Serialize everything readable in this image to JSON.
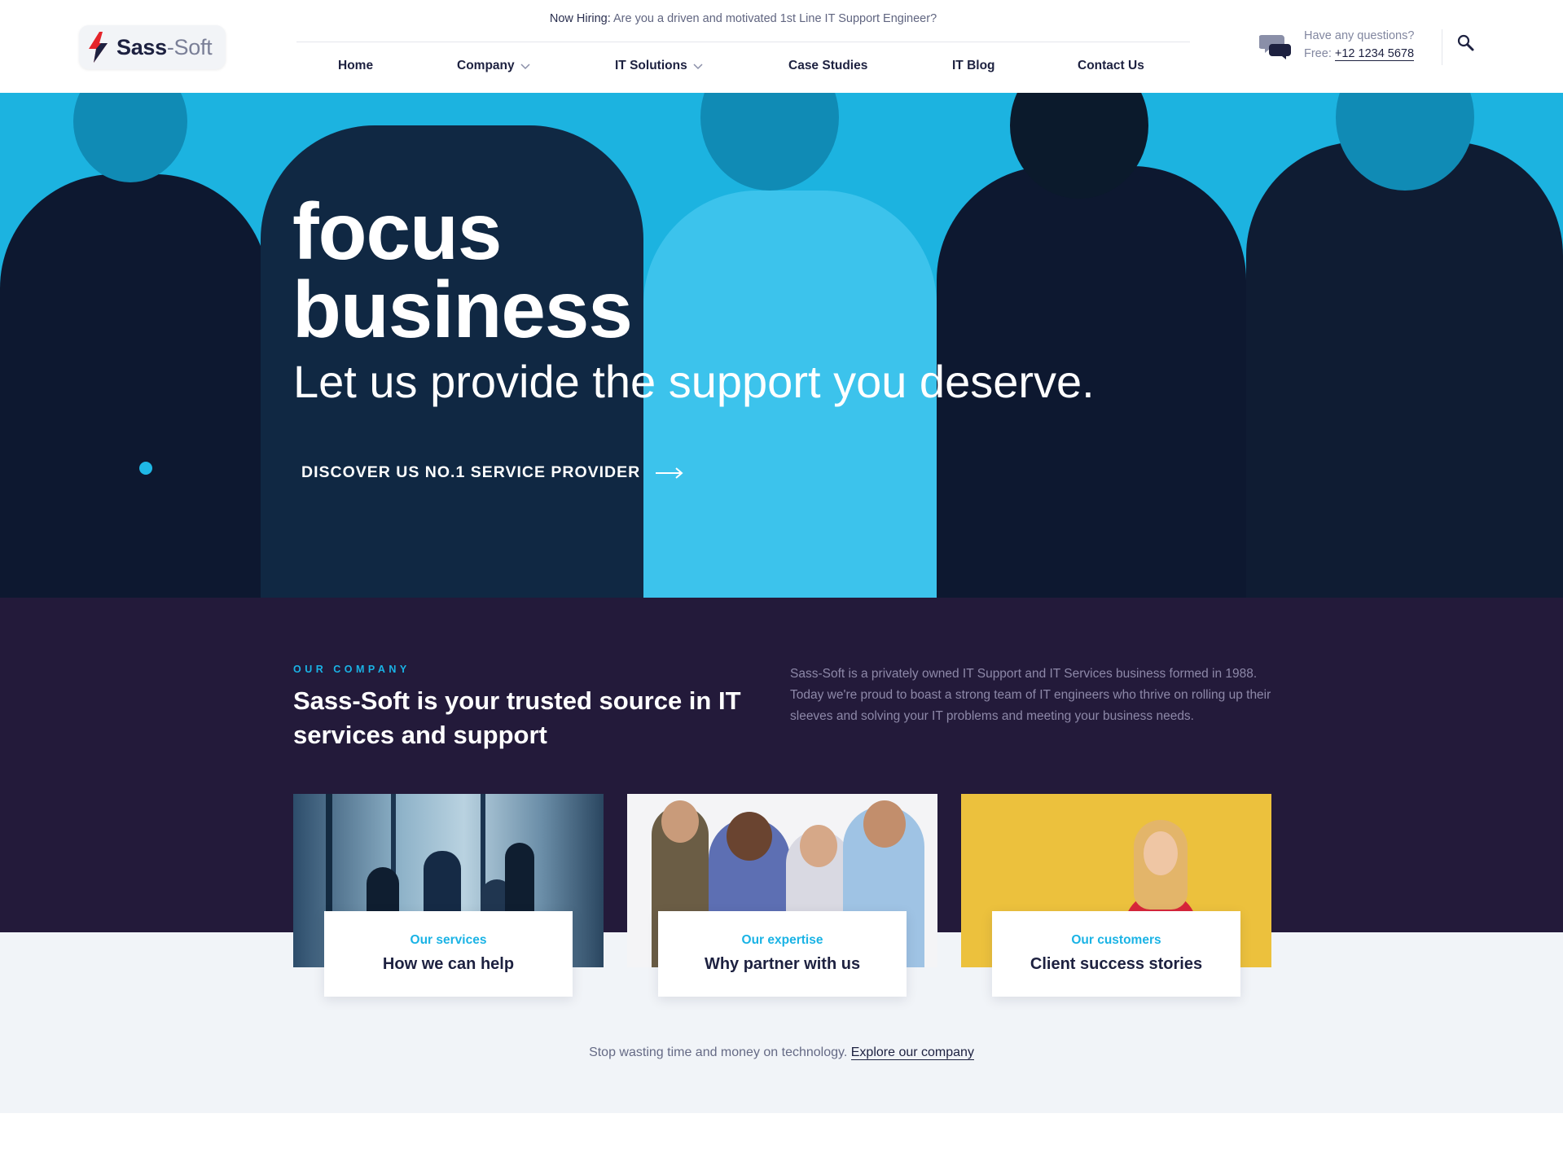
{
  "header": {
    "logo": {
      "part1": "Sass",
      "part2": "-Soft"
    },
    "topbar": {
      "label": "Now Hiring:",
      "text": "Are you a driven and motivated 1st Line IT Support Engineer?"
    },
    "nav": [
      {
        "label": "Home",
        "has_dropdown": false
      },
      {
        "label": "Company",
        "has_dropdown": true
      },
      {
        "label": "IT Solutions",
        "has_dropdown": true
      },
      {
        "label": "Case Studies",
        "has_dropdown": false
      },
      {
        "label": "IT Blog",
        "has_dropdown": false
      },
      {
        "label": "Contact Us",
        "has_dropdown": false
      }
    ],
    "help": {
      "question": "Have any questions?",
      "phone_label": "Free:",
      "phone": "+12 1234 5678",
      "icon": "chat-bubbles-icon"
    },
    "search_icon": "search-icon"
  },
  "hero": {
    "title_line1": "focus",
    "title_line2": "business",
    "subtitle": "Let us provide the support you deserve.",
    "cta": "DISCOVER US NO.1 SERVICE PROVIDER",
    "accent": "#1cb3e0"
  },
  "company": {
    "eyebrow": "OUR COMPANY",
    "title": "Sass-Soft is your trusted source in IT services and support",
    "description": "Sass-Soft is a privately owned IT Support and IT Services business formed in 1988. Today we're proud to boast a strong team of IT engineers who thrive on rolling up their sleeves and solving your IT problems and meeting your business needs.",
    "cards": [
      {
        "kicker": "Our services",
        "title": "How we can help"
      },
      {
        "kicker": "Our expertise",
        "title": "Why partner with us"
      },
      {
        "kicker": "Our customers",
        "title": "Client success stories"
      }
    ],
    "explore": {
      "text": "Stop wasting time and money on technology.",
      "link": "Explore our company"
    },
    "bg": "#231a3a"
  }
}
